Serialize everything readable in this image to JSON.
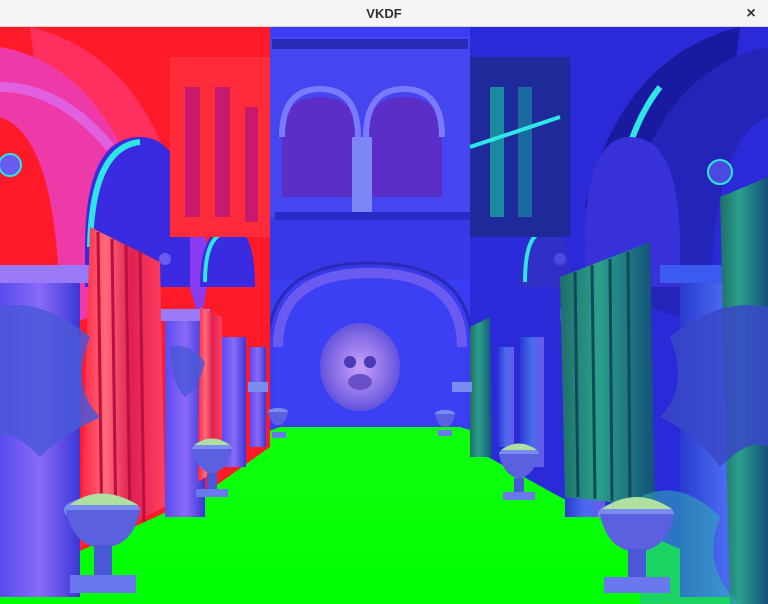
{
  "window": {
    "title": "VKDF",
    "close_glyph": "×",
    "close_icon": "close-icon"
  },
  "scene": {
    "description_icon": "rendered-3d-scene",
    "colors": {
      "sky_wall": "#3b3df2",
      "left_arcade": "#ff1a2a",
      "left_arcade_pink": "#ee3aa8",
      "right_arcade": "#2a2ad8",
      "right_arcade_dark": "#1a1a9a",
      "floor": "#00ff00",
      "cyan_accent": "#2ee6e6",
      "curtain_red": "#ff3c5a",
      "curtain_green": "#2a8a6a"
    }
  }
}
